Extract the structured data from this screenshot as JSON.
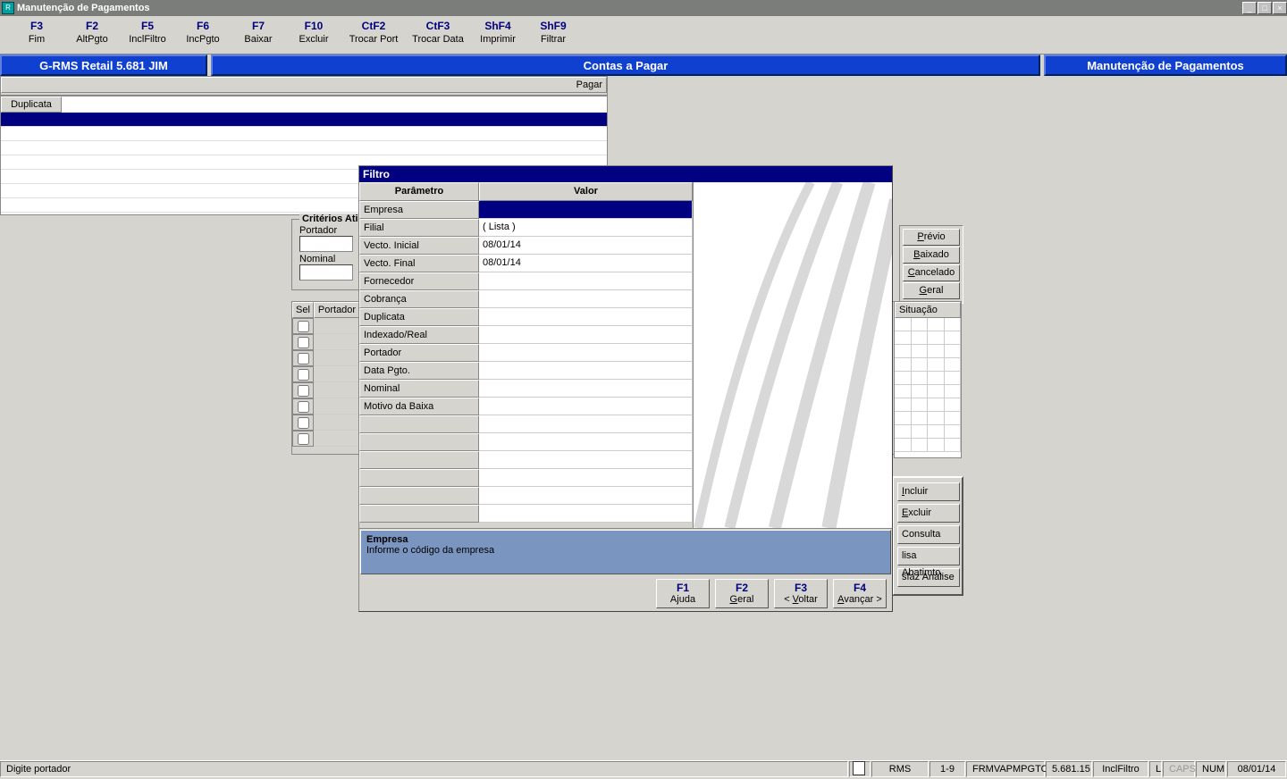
{
  "window": {
    "title": "Manutenção de Pagamentos"
  },
  "fkeys": [
    {
      "key": "F3",
      "label": "Fim"
    },
    {
      "key": "F2",
      "label": "AltPgto"
    },
    {
      "key": "F5",
      "label": "InclFiltro"
    },
    {
      "key": "F6",
      "label": "IncPgto"
    },
    {
      "key": "F7",
      "label": "Baixar"
    },
    {
      "key": "F10",
      "label": "Excluir"
    },
    {
      "key": "CtF2",
      "label": "Trocar Port"
    },
    {
      "key": "CtF3",
      "label": "Trocar Data"
    },
    {
      "key": "ShF4",
      "label": "Imprimir"
    },
    {
      "key": "ShF9",
      "label": "Filtrar"
    }
  ],
  "banner": {
    "left": "G-RMS Retail 5.681 JIM",
    "mid": "Contas a Pagar",
    "right": "Manutenção de Pagamentos"
  },
  "criterios": {
    "legend": "Critérios Ati",
    "portador_label": "Portador",
    "nominal_label": "Nominal"
  },
  "list_headers": {
    "sel": "Sel",
    "portador": "Portador"
  },
  "pagar_label": "Pagar",
  "dup_header": "Duplicata",
  "top_buttons": {
    "previo": "Prévio",
    "baixado": "Baixado",
    "cancelado": "Cancelado",
    "geral": "Geral"
  },
  "situacao_header": "Situação",
  "lr_buttons": {
    "incluir": "Incluir",
    "excluir": "Excluir",
    "consulta": "Consulta",
    "lisaabat": "lisa Abatimto.",
    "sfazanalise": "sfaz Análise"
  },
  "filtro": {
    "title": "Filtro",
    "col_param": "Parâmetro",
    "col_valor": "Valor",
    "rows": [
      {
        "p": "Empresa",
        "v": ""
      },
      {
        "p": "Filial",
        "v": "( Lista )"
      },
      {
        "p": "Vecto. Inicial",
        "v": "08/01/14"
      },
      {
        "p": "Vecto. Final",
        "v": "08/01/14"
      },
      {
        "p": "Fornecedor",
        "v": ""
      },
      {
        "p": "Cobrança",
        "v": ""
      },
      {
        "p": "Duplicata",
        "v": ""
      },
      {
        "p": "Indexado/Real",
        "v": ""
      },
      {
        "p": "Portador",
        "v": ""
      },
      {
        "p": "Data Pgto.",
        "v": ""
      },
      {
        "p": "Nominal",
        "v": ""
      },
      {
        "p": "Motivo da Baixa",
        "v": ""
      }
    ],
    "hint_title": "Empresa",
    "hint_desc": "Informe o código da empresa",
    "buttons": [
      {
        "key": "F1",
        "label": "Ajuda"
      },
      {
        "key": "F2",
        "label": "Geral"
      },
      {
        "key": "F3",
        "label": "< Voltar"
      },
      {
        "key": "F4",
        "label": "Avançar >"
      }
    ]
  },
  "status": {
    "msg": "Digite portador",
    "app": "RMS",
    "range": "1-9",
    "form": "FRMVAPMPGTO",
    "ver": "5.681.15",
    "mode": "InclFiltro",
    "caps_l": "L",
    "caps": "CAPS",
    "num": "NUM",
    "date": "08/01/14"
  }
}
